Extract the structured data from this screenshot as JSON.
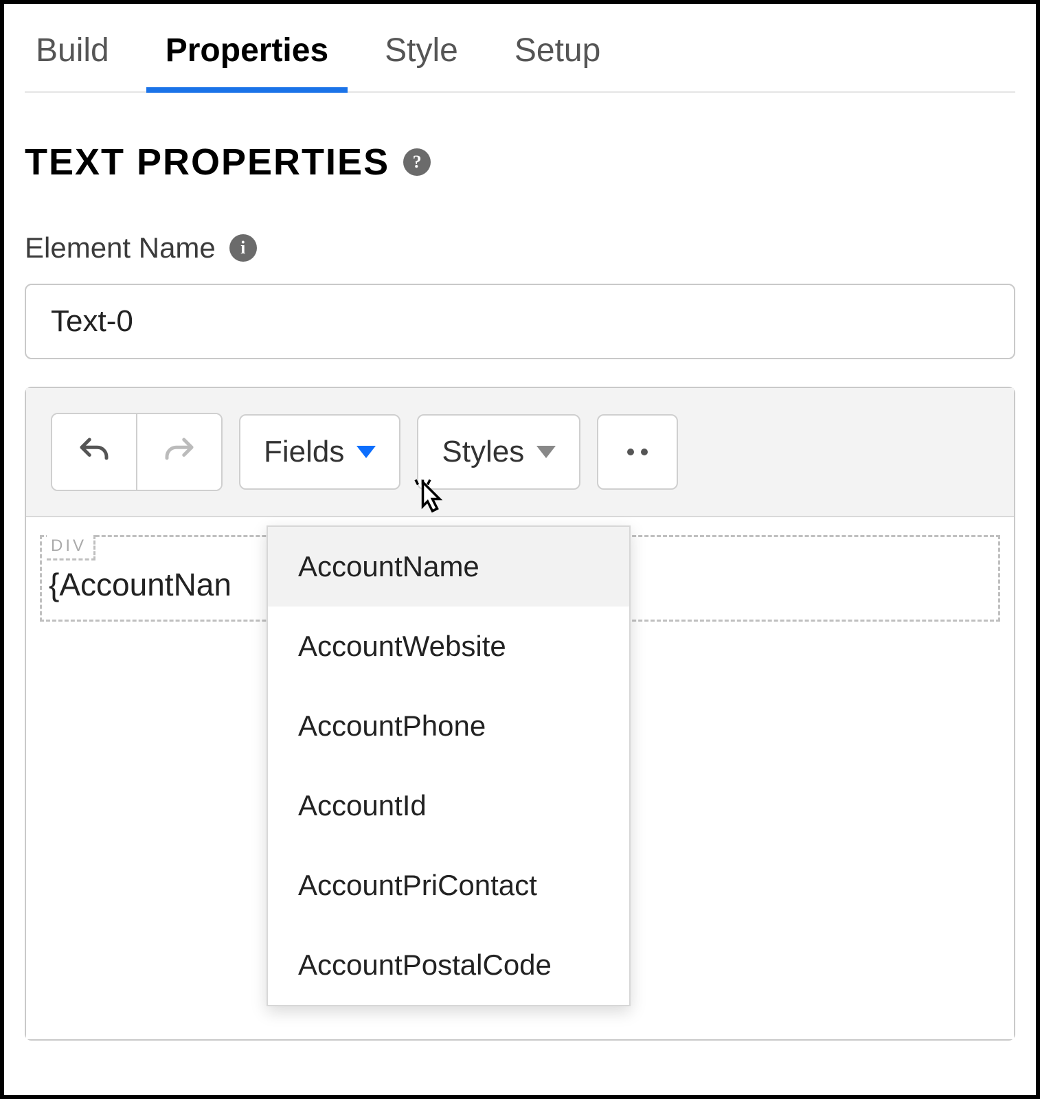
{
  "tabs": {
    "build": "Build",
    "properties": "Properties",
    "style": "Style",
    "setup": "Setup",
    "active": "properties"
  },
  "section": {
    "title": "Text Properties"
  },
  "elementName": {
    "label": "Element Name",
    "value": "Text-0"
  },
  "toolbar": {
    "fields_label": "Fields",
    "styles_label": "Styles"
  },
  "canvas": {
    "tag": "DIV",
    "content": "{AccountNan"
  },
  "fieldsDropdown": {
    "items": [
      "AccountName",
      "AccountWebsite",
      "AccountPhone",
      "AccountId",
      "AccountPriContact",
      "AccountPostalCode"
    ],
    "hoverIndex": 0
  }
}
